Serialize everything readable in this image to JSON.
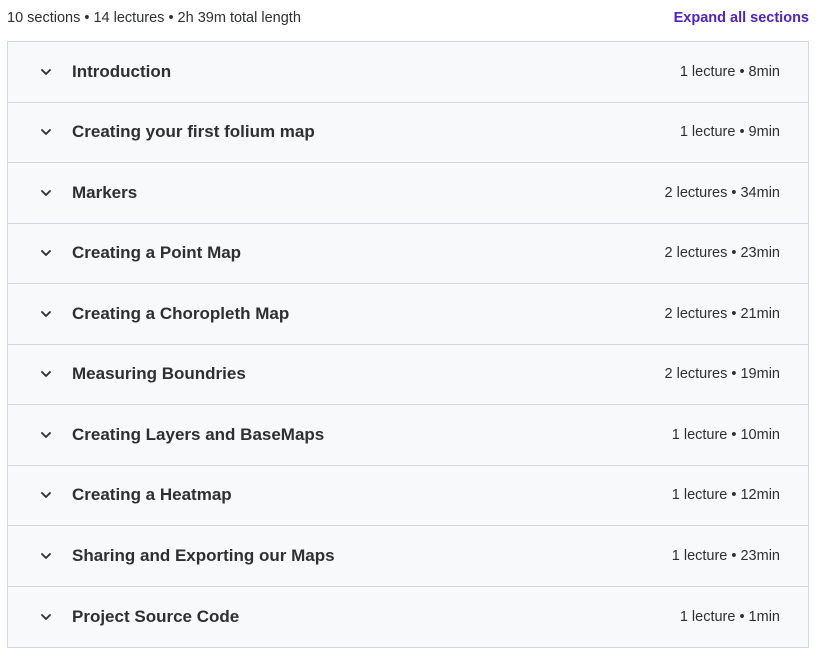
{
  "summary": {
    "text": "10 sections • 14 lectures • 2h 39m total length",
    "expand_label": "Expand all sections"
  },
  "icons": {
    "section_toggle": "chevron-down-icon"
  },
  "colors": {
    "accent": "#5022c3",
    "row_background": "#f7f9fa",
    "border": "#d1d7dc"
  },
  "sections": [
    {
      "title": "Introduction",
      "meta": "1 lecture • 8min"
    },
    {
      "title": "Creating your first folium map",
      "meta": "1 lecture • 9min"
    },
    {
      "title": "Markers",
      "meta": "2 lectures • 34min"
    },
    {
      "title": "Creating a Point Map",
      "meta": "2 lectures • 23min"
    },
    {
      "title": "Creating a Choropleth Map",
      "meta": "2 lectures • 21min"
    },
    {
      "title": "Measuring Boundries",
      "meta": "2 lectures • 19min"
    },
    {
      "title": "Creating Layers and BaseMaps",
      "meta": "1 lecture • 10min"
    },
    {
      "title": "Creating a Heatmap",
      "meta": "1 lecture • 12min"
    },
    {
      "title": "Sharing and Exporting our Maps",
      "meta": "1 lecture • 23min"
    },
    {
      "title": "Project Source Code",
      "meta": "1 lecture • 1min"
    }
  ]
}
